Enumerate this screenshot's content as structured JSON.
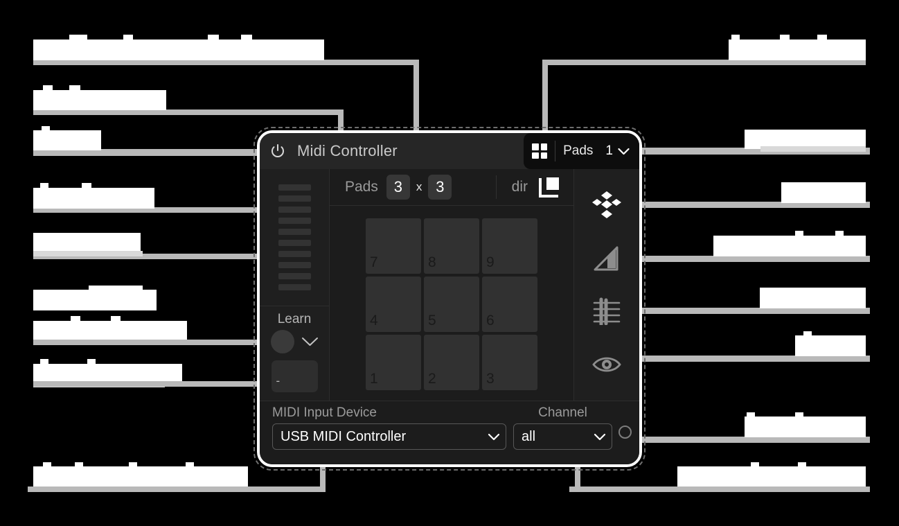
{
  "window": {
    "title": "Midi Controller",
    "power_icon": "power-icon",
    "header_right": {
      "grid_icon": "grid-layout-icon",
      "label": "Pads",
      "value": "1",
      "chevron_icon": "chevron-down-icon"
    }
  },
  "param_bar": {
    "pads_label": "Pads",
    "cols": "3",
    "times": "x",
    "rows": "3",
    "dir_label": "dir",
    "dir_icon": "direction-corner-icon"
  },
  "left_column": {
    "fader": {
      "name": "level-fader",
      "segments": 10
    },
    "learn": {
      "label": "Learn",
      "knob_icon": "learn-knob",
      "chevron_icon": "chevron-down-icon",
      "display_value": "-"
    }
  },
  "pads": {
    "rows": 3,
    "cols": 3,
    "labels": [
      [
        "7",
        "8",
        "9"
      ],
      [
        "4",
        "5",
        "6"
      ],
      [
        "1",
        "2",
        "3"
      ]
    ]
  },
  "rail": {
    "items": [
      {
        "icon": "layers-stack-icon",
        "active": true
      },
      {
        "icon": "velocity-ramp-icon",
        "active": false
      },
      {
        "icon": "alignment-lines-icon",
        "active": false
      },
      {
        "icon": "eye-visibility-icon",
        "active": false
      }
    ]
  },
  "footer": {
    "device_label": "MIDI Input Device",
    "device_value": "USB MIDI Controller",
    "channel_label": "Channel",
    "channel_value": "all",
    "led_icon": "midi-activity-led",
    "chevron_icon": "chevron-down-icon"
  },
  "annotations": {
    "note": "callout labels are redacted/blurred in the source image",
    "left": [
      {
        "id": "pad-grid-height-selector",
        "blocks": 1
      },
      {
        "id": "plugin-name",
        "blocks": 1
      },
      {
        "id": "on-off",
        "blocks": 1
      },
      {
        "id": "input-meter",
        "blocks": 1
      },
      {
        "id": "pad-button",
        "blocks": 1
      },
      {
        "id": "midi-learn-trigger-selector",
        "blocks": 2
      },
      {
        "id": "note-indicator",
        "blocks": 1
      },
      {
        "id": "input-device-selector",
        "blocks": 1
      }
    ],
    "right": [
      {
        "id": "pad-direction",
        "blocks": 1
      },
      {
        "id": "layers-toggle",
        "blocks": 1
      },
      {
        "id": "pad-count",
        "blocks": 1
      },
      {
        "id": "sensitivity-slider",
        "blocks": 1
      },
      {
        "id": "alignment",
        "blocks": 1
      },
      {
        "id": "hide-show",
        "blocks": 1
      },
      {
        "id": "midi-indicator",
        "blocks": 1
      },
      {
        "id": "midi-input-channel",
        "blocks": 1
      }
    ]
  }
}
